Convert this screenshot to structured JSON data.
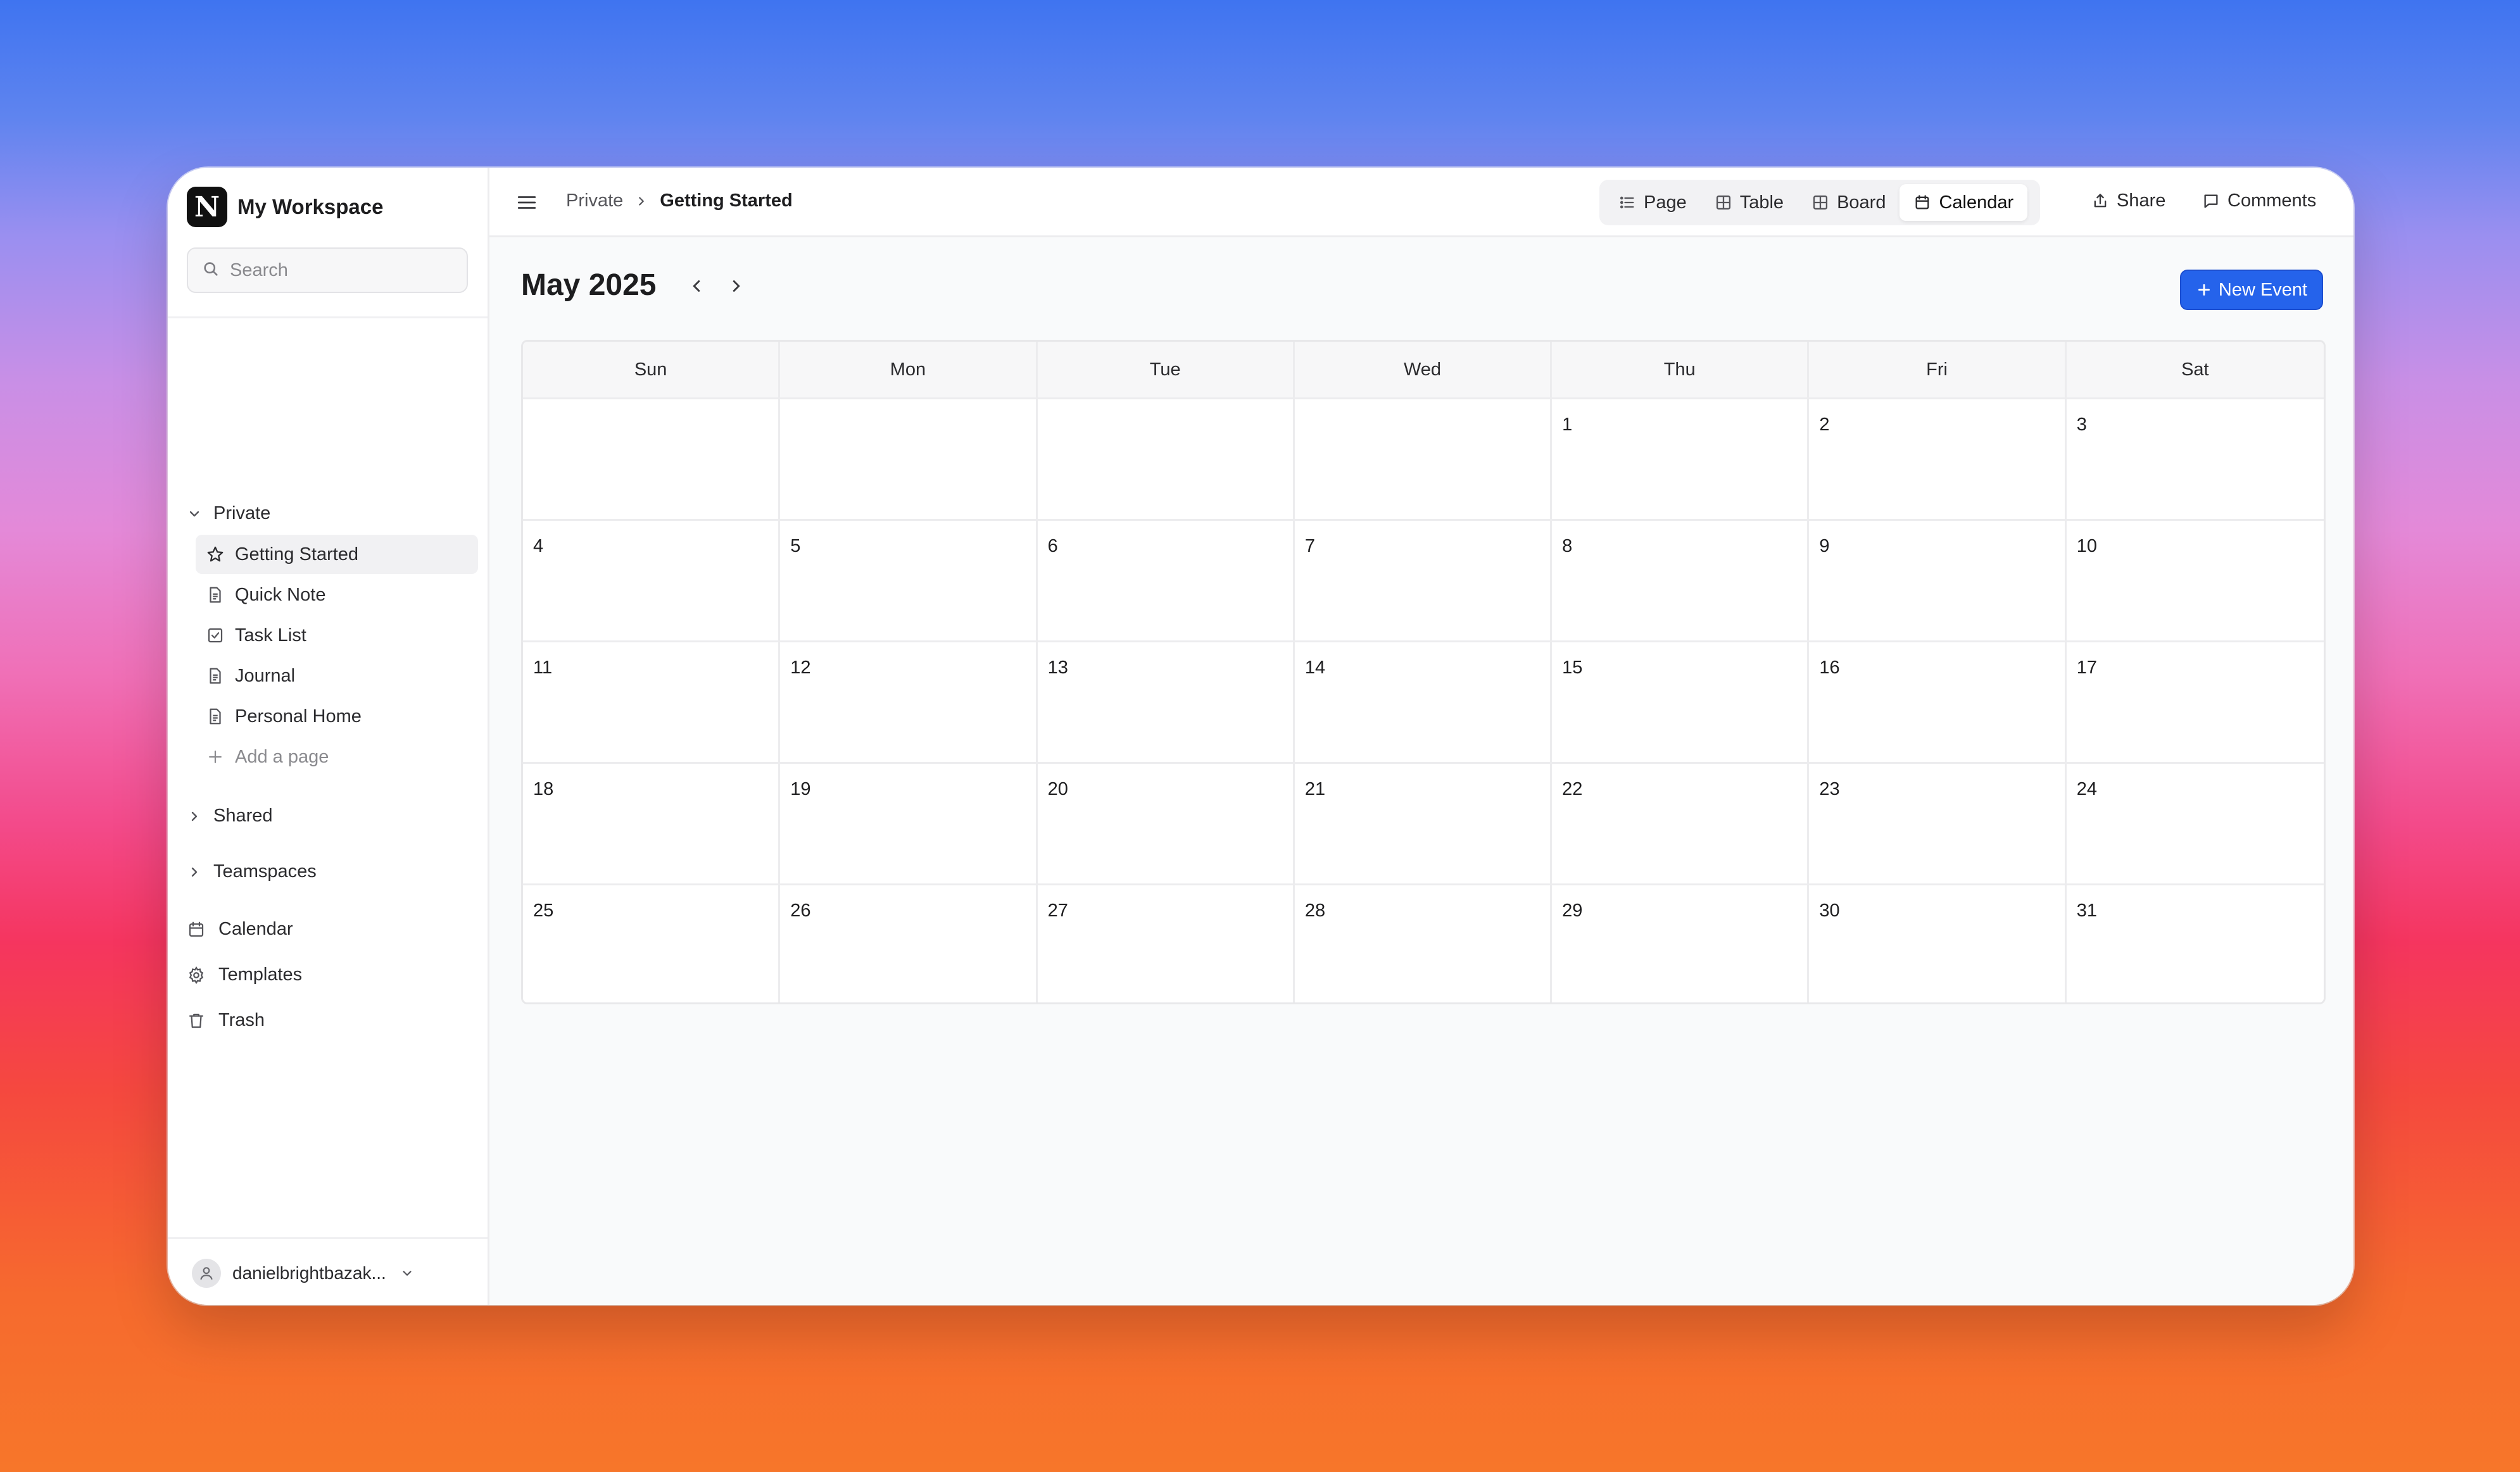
{
  "workspace": {
    "logo_letter": "N",
    "name": "My Workspace"
  },
  "search": {
    "placeholder": "Search"
  },
  "sidebar": {
    "private_label": "Private",
    "items": [
      {
        "label": "Getting Started",
        "icon": "star-icon",
        "active": true
      },
      {
        "label": "Quick Note",
        "icon": "document-icon"
      },
      {
        "label": "Task List",
        "icon": "checkbox-icon"
      },
      {
        "label": "Journal",
        "icon": "document-icon"
      },
      {
        "label": "Personal Home",
        "icon": "document-icon"
      }
    ],
    "add_page_label": "Add a page",
    "shared_label": "Shared",
    "teamspaces_label": "Teamspaces",
    "tools": [
      {
        "label": "Calendar",
        "icon": "calendar-icon"
      },
      {
        "label": "Templates",
        "icon": "gear-icon"
      },
      {
        "label": "Trash",
        "icon": "trash-icon"
      }
    ],
    "user_label": "danielbrightbazak..."
  },
  "breadcrumb": {
    "parent": "Private",
    "current": "Getting Started"
  },
  "views": {
    "page": "Page",
    "table": "Table",
    "board": "Board",
    "calendar": "Calendar",
    "active": "Calendar"
  },
  "actions": {
    "share": "Share",
    "comments": "Comments"
  },
  "calendar": {
    "title": "May 2025",
    "new_event": "New Event",
    "days_of_week": [
      "Sun",
      "Mon",
      "Tue",
      "Wed",
      "Thu",
      "Fri",
      "Sat"
    ],
    "cells": [
      "",
      "",
      "",
      "",
      "1",
      "2",
      "3",
      "4",
      "5",
      "6",
      "7",
      "8",
      "9",
      "10",
      "11",
      "12",
      "13",
      "14",
      "15",
      "16",
      "17",
      "18",
      "19",
      "20",
      "21",
      "22",
      "23",
      "24",
      "25",
      "26",
      "27",
      "28",
      "29",
      "30",
      "31"
    ]
  },
  "colors": {
    "accent": "#2563eb"
  }
}
